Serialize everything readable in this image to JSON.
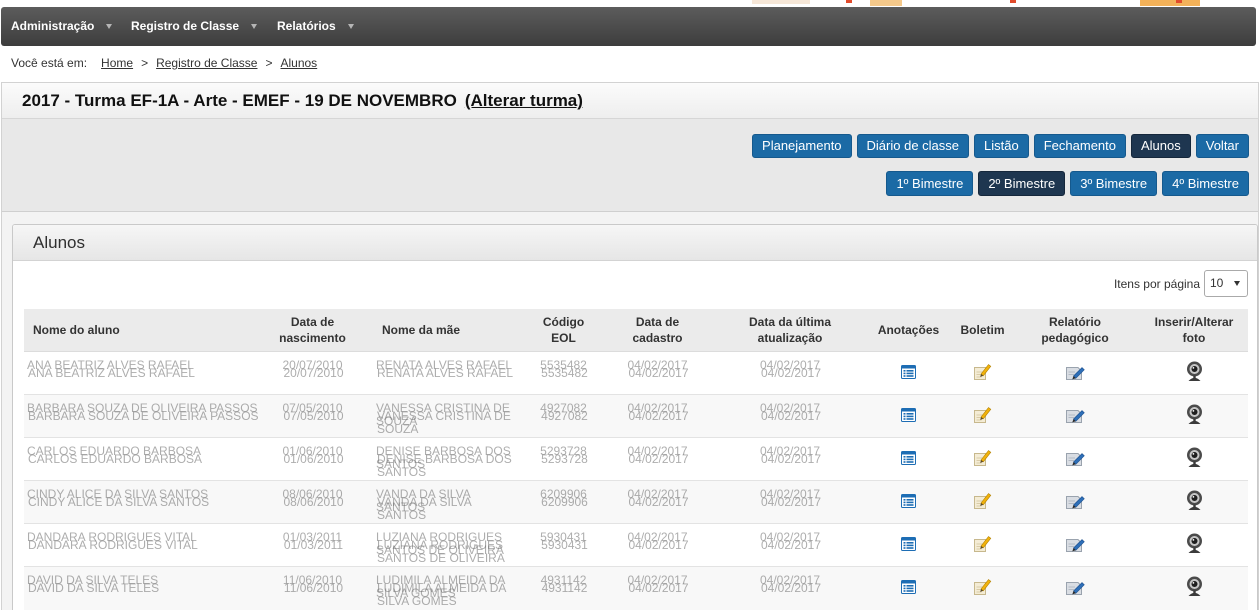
{
  "nav": {
    "items": [
      {
        "label": "Administração"
      },
      {
        "label": "Registro de Classe"
      },
      {
        "label": "Relatórios"
      }
    ]
  },
  "breadcrumb": {
    "prefix": "Você está em:",
    "separator": ">",
    "items": [
      "Home",
      "Registro de Classe",
      "Alunos"
    ]
  },
  "class_header": {
    "title": "2017 - Turma EF-1A - Arte - EMEF - 19 DE NOVEMBRO",
    "change_link": "(Alterar turma)"
  },
  "actions": [
    {
      "label": "Planejamento",
      "active": false
    },
    {
      "label": "Diário de classe",
      "active": false
    },
    {
      "label": "Listão",
      "active": false
    },
    {
      "label": "Fechamento",
      "active": false
    },
    {
      "label": "Alunos",
      "active": true
    },
    {
      "label": "Voltar",
      "active": false
    }
  ],
  "periods": [
    {
      "label": "1º Bimestre",
      "active": false
    },
    {
      "label": "2º Bimestre",
      "active": true
    },
    {
      "label": "3º Bimestre",
      "active": false
    },
    {
      "label": "4º Bimestre",
      "active": false
    }
  ],
  "students_panel": {
    "title": "Alunos",
    "per_page_label": "Itens por página",
    "per_page_value": "10"
  },
  "table": {
    "columns": [
      "Nome do aluno",
      "Data de nascimento",
      "Nome da mãe",
      "Código EOL",
      "Data de cadastro",
      "Data da última atualização",
      "Anotações",
      "Boletim",
      "Relatório pedagógico",
      "Inserir/Alterar foto"
    ],
    "row_icons": {
      "annotations": "annotations-icon",
      "report_card": "notepad-pencil-icon",
      "pedagogical_report": "document-pencil-icon",
      "photo": "webcam-icon"
    },
    "rows": [
      {
        "student_name": "ANA BEATRIZ ALVES RAFAEL",
        "birth_date": "20/07/2010",
        "mother_name": "RENATA ALVES RAFAEL",
        "eol_code": "5535482",
        "registration_date": "04/02/2017",
        "last_update": "04/02/2017"
      },
      {
        "student_name": "BARBARA SOUZA DE OLIVEIRA PASSOS",
        "birth_date": "07/05/2010",
        "mother_name": "VANESSA CRISTINA DE SOUZA",
        "eol_code": "4927082",
        "registration_date": "04/02/2017",
        "last_update": "04/02/2017"
      },
      {
        "student_name": "CARLOS EDUARDO BARBOSA",
        "birth_date": "01/06/2010",
        "mother_name": "DENISE BARBOSA DOS SANTOS",
        "eol_code": "5293728",
        "registration_date": "04/02/2017",
        "last_update": "04/02/2017"
      },
      {
        "student_name": "CINDY ALICE DA SILVA SANTOS",
        "birth_date": "08/06/2010",
        "mother_name": "VANDA DA SILVA SANTOS",
        "eol_code": "6209906",
        "registration_date": "04/02/2017",
        "last_update": "04/02/2017"
      },
      {
        "student_name": "DANDARA RODRIGUES VITAL",
        "birth_date": "01/03/2011",
        "mother_name": "LUZIANA RODRIGUES SANTOS DE OLIVEIRA",
        "eol_code": "5930431",
        "registration_date": "04/02/2017",
        "last_update": "04/02/2017"
      },
      {
        "student_name": "DAVID DA SILVA TELES",
        "birth_date": "11/06/2010",
        "mother_name": "LUDIMILA ALMEIDA DA SILVA GOMES",
        "eol_code": "4931142",
        "registration_date": "04/02/2017",
        "last_update": "04/02/2017"
      }
    ]
  },
  "colors": {
    "nav_background": "#444444",
    "primary_button": "#1b6aa5",
    "active_button": "#1e3650",
    "annotations_icon": "#1d6db4"
  }
}
